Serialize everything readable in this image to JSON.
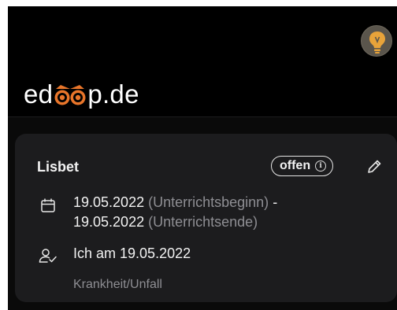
{
  "brand": {
    "logo_prefix": "ed",
    "logo_suffix": "p.de",
    "logo_full": "edoop.de"
  },
  "header": {
    "avatar_icon": "lightbulb-icon",
    "avatar_color": "#5a554c"
  },
  "absence_card": {
    "name": "Lisbet",
    "status_label": "offen",
    "status_icon": "info-icon",
    "edit_icon": "pencil-icon",
    "start_date": "19.05.2022",
    "start_note": "(Unterrichtsbeginn)",
    "separator": "-",
    "end_date": "19.05.2022",
    "end_note": "(Unterrichtsende)",
    "reported_by": "Ich am 19.05.2022",
    "reason": "Krankheit/Unfall",
    "date_icon": "calendar-icon",
    "person_icon": "person-check-icon"
  },
  "colors": {
    "background": "#000000",
    "card": "#1c1c1e",
    "text": "#f2f2f2",
    "muted_text": "#8e8e93",
    "accent_orange": "#e8752a"
  }
}
